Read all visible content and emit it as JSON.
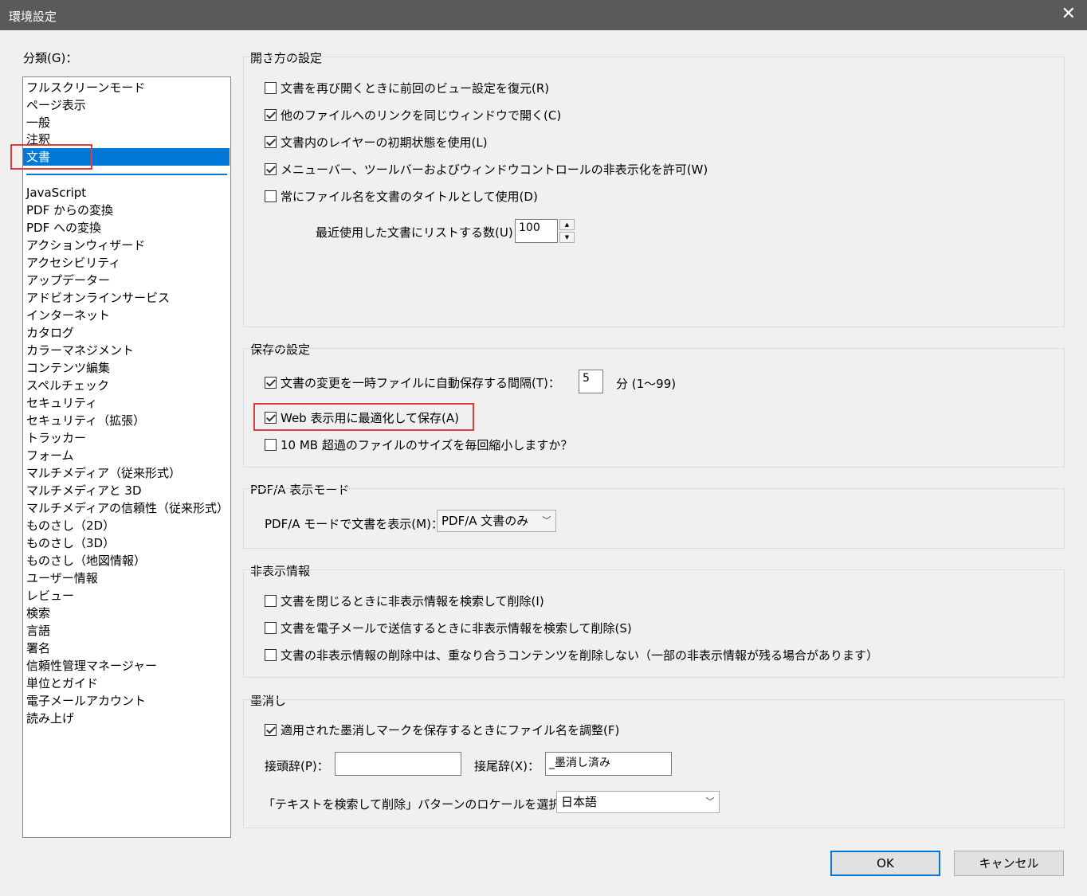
{
  "window": {
    "title": "環境設定",
    "close_glyph": "✕"
  },
  "categories": {
    "label": "分類(G)：",
    "items": [
      "フルスクリーンモード",
      "ページ表示",
      "一般",
      "注釈",
      "文書",
      "JavaScript",
      "PDF からの変換",
      "PDF への変換",
      "アクションウィザード",
      "アクセシビリティ",
      "アップデーター",
      "アドビオンラインサービス",
      "インターネット",
      "カタログ",
      "カラーマネジメント",
      "コンテンツ編集",
      "スペルチェック",
      "セキュリティ",
      "セキュリティ（拡張）",
      "トラッカー",
      "フォーム",
      "マルチメディア（従来形式）",
      "マルチメディアと 3D",
      "マルチメディアの信頼性（従来形式）",
      "ものさし（2D）",
      "ものさし（3D）",
      "ものさし（地図情報）",
      "ユーザー情報",
      "レビュー",
      "検索",
      "言語",
      "署名",
      "信頼性管理マネージャー",
      "単位とガイド",
      "電子メールアカウント",
      "読み上げ"
    ],
    "selected": "文書"
  },
  "open_settings": {
    "title": "開き方の設定",
    "checkboxes": [
      {
        "label": "文書を再び開くときに前回のビュー設定を復元(R)",
        "checked": false
      },
      {
        "label": "他のファイルへのリンクを同じウィンドウで開く(C)",
        "checked": true
      },
      {
        "label": "文書内のレイヤーの初期状態を使用(L)",
        "checked": true
      },
      {
        "label": "メニューバー、ツールバーおよびウィンドウコントロールの非表示化を許可(W)",
        "checked": true
      },
      {
        "label": "常にファイル名を文書のタイトルとして使用(D)",
        "checked": false
      }
    ],
    "recent_label": "最近使用した文書にリストする数(U)：",
    "recent_value": "100"
  },
  "save_settings": {
    "title": "保存の設定",
    "autosave_label": "文書の変更を一時ファイルに自動保存する間隔(T)：",
    "autosave_checked": true,
    "autosave_value": "5",
    "autosave_unit": "分 (1〜99)",
    "web_optimize_label": "Web 表示用に最適化して保存(A)",
    "web_optimize_checked": true,
    "reduce_label": "10 MB 超過のファイルのサイズを毎回縮小しますか？",
    "reduce_checked": false
  },
  "pdfa": {
    "title": "PDF/A 表示モード",
    "label": "PDF/A モードで文書を表示(M)：",
    "value": "PDF/A 文書のみ"
  },
  "hidden_info": {
    "title": "非表示情報",
    "checkboxes": [
      {
        "label": "文書を閉じるときに非表示情報を検索して削除(I)",
        "checked": false
      },
      {
        "label": "文書を電子メールで送信するときに非表示情報を検索して削除(S)",
        "checked": false
      },
      {
        "label": "文書の非表示情報の削除中は、重なり合うコンテンツを削除しない（一部の非表示情報が残る場合があります）",
        "checked": false
      }
    ]
  },
  "redaction": {
    "title": "墨消し",
    "adjust_label": "適用された墨消しマークを保存するときにファイル名を調整(F)",
    "adjust_checked": true,
    "prefix_label": "接頭辞(P)：",
    "prefix_value": "",
    "suffix_label": "接尾辞(X)：",
    "suffix_value": "_墨消し済み",
    "locale_label": "「テキストを検索して削除」パターンのロケールを選択(H)：",
    "locale_value": "日本語"
  },
  "buttons": {
    "ok": "OK",
    "cancel": "キャンセル"
  }
}
